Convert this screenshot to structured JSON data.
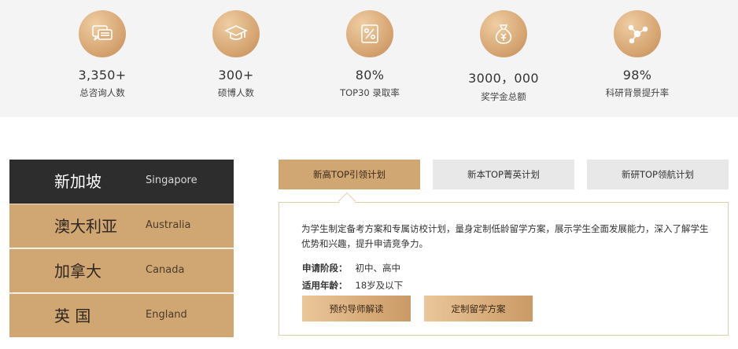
{
  "stats": [
    {
      "icon": "chat-bubbles-icon",
      "value": "3,350+",
      "label": "总咨询人数"
    },
    {
      "icon": "graduation-cap-icon",
      "value": "300+",
      "label": "硕博人数"
    },
    {
      "icon": "percent-icon",
      "value": "80%",
      "label": "TOP30 录取率"
    },
    {
      "icon": "money-bag-icon",
      "value": "3000，000",
      "label": "奖学金总额"
    },
    {
      "icon": "network-nodes-icon",
      "value": "98%",
      "label": "科研背景提升率"
    }
  ],
  "countries": [
    {
      "zh": "新加坡",
      "en": "Singapore",
      "active": true
    },
    {
      "zh": "澳大利亚",
      "en": "Australia",
      "active": false
    },
    {
      "zh": "加拿大",
      "en": "Canada",
      "active": false
    },
    {
      "zh": "英 国",
      "en": "England",
      "active": false
    }
  ],
  "tabs": [
    {
      "label": "新高TOP引领计划",
      "active": true
    },
    {
      "label": "新本TOP菁英计划",
      "active": false
    },
    {
      "label": "新研TOP领航计划",
      "active": false
    }
  ],
  "panel": {
    "description": "为学生制定备考方案和专属访校计划，量身定制低龄留学方案，展示学生全面发展能力，深入了解学生优势和兴趣，提升申请竞争力。",
    "stage_label": "申请阶段：",
    "stage_value": "初中、高中",
    "age_label": "适用年龄：",
    "age_value": "18岁及以下",
    "btn_consult": "预约导师解读",
    "btn_plan": "定制留学方案"
  },
  "colors": {
    "accent": "#d0a672",
    "dark": "#2e2d2d",
    "band": "#f4f4f4"
  }
}
